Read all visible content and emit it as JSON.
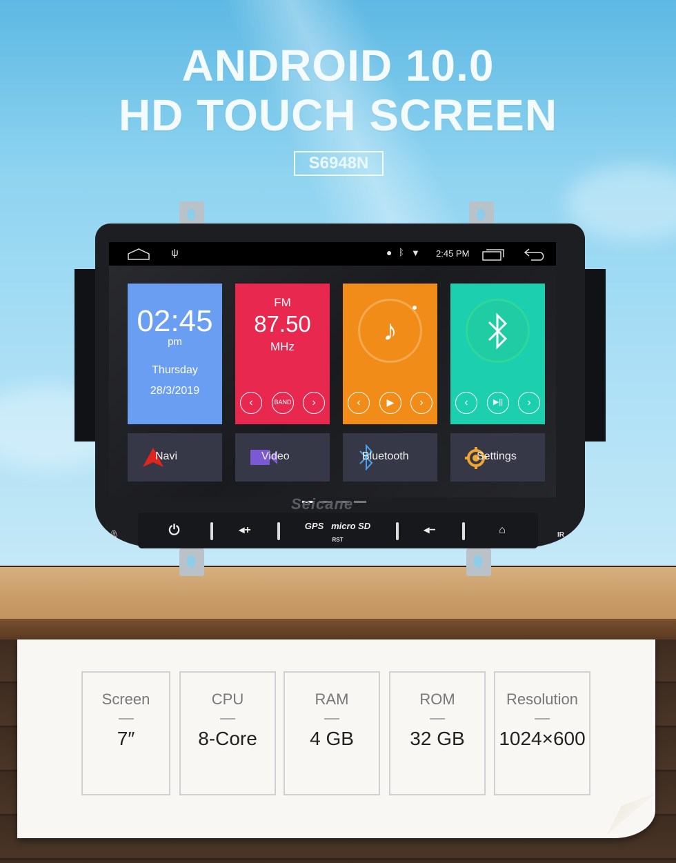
{
  "header": {
    "title_line1": "ANDROID 10.0",
    "title_line2": "HD TOUCH SCREEN",
    "model": "S6948N"
  },
  "statusbar": {
    "icons_left": [
      "home-outline-icon",
      "usb-icon"
    ],
    "icons_right": [
      "location-icon",
      "bluetooth-icon",
      "wifi-icon"
    ],
    "time": "2:45 PM",
    "nav_icons": [
      "recent-apps-icon",
      "back-icon"
    ]
  },
  "tiles": {
    "clock": {
      "time": "02:45",
      "ampm": "pm",
      "day": "Thursday",
      "date": "28/3/2019",
      "color": "#6a9ef2"
    },
    "radio": {
      "band": "FM",
      "freq": "87.50",
      "unit": "MHz",
      "band_button": "BAND",
      "color": "#e8284f"
    },
    "music": {
      "color": "#f28c18"
    },
    "bt_music": {
      "color": "#1ccfaf"
    }
  },
  "apps": [
    {
      "label": "Navi",
      "icon": "navigation-arrow-icon"
    },
    {
      "label": "Video",
      "icon": "video-camera-icon"
    },
    {
      "label": "Bluetooth",
      "icon": "bluetooth-icon"
    },
    {
      "label": "Settings",
      "icon": "gear-icon"
    }
  ],
  "hardware": {
    "brand": "Seicane",
    "gps": "GPS",
    "sd": "micro SD",
    "rst": "RST",
    "ir": "IR"
  },
  "specs": [
    {
      "label": "Screen",
      "value": "7″"
    },
    {
      "label": "CPU",
      "value": "8-Core"
    },
    {
      "label": "RAM",
      "value": "4 GB"
    },
    {
      "label": "ROM",
      "value": "32 GB"
    },
    {
      "label": "Resolution",
      "value": "1024×600"
    }
  ]
}
